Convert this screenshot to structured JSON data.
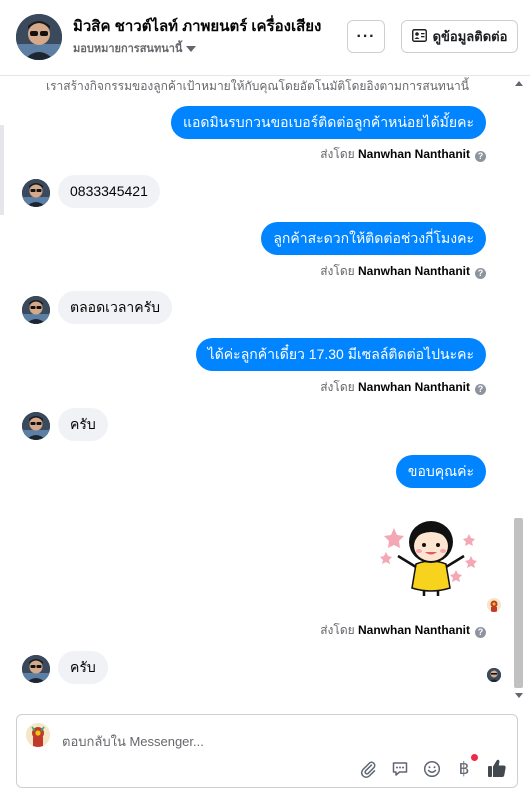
{
  "header": {
    "page_name": "มิวสิค ชาวต์ไลท์ ภาพยนตร์ เครื่องเสียง",
    "assign_label": "มอบหมายการสนทนานี้",
    "more_label": "···",
    "contact_button_label": "ดูข้อมูลติดต่อ"
  },
  "thread": {
    "notice": "เราสร้างกิจกรรมของลูกค้าเป้าหมายให้กับคุณโดยอัตโนมัติโดยอิงตามการสนทนานี้",
    "sent_by_prefix": "ส่งโดย",
    "sender_name": "Nanwhan Nanthanit",
    "help_glyph": "?",
    "messages": [
      {
        "text": "แอดมินรบกวนขอเบอร์ติดต่อลูกค้าหน่อยได้มั้ยคะ"
      },
      {
        "text": "0833345421"
      },
      {
        "text": "ลูกค้าสะดวกให้ติดต่อช่วงกี่โมงคะ"
      },
      {
        "text": "ตลอดเวลาครับ"
      },
      {
        "text": "ได้ค่ะลูกค้าเดี๋ยว 17.30 มีเซลล์ติดต่อไปนะคะ"
      },
      {
        "text": "ครับ"
      },
      {
        "text": "ขอบคุณค่ะ"
      },
      {
        "text": "ครับ"
      }
    ]
  },
  "composer": {
    "placeholder": "ตอบกลับใน Messenger...",
    "currency_glyph": "฿"
  },
  "colors": {
    "outgoing_bubble": "#0084ff",
    "incoming_bubble": "#f0f2f5",
    "like_icon": "#444950"
  }
}
